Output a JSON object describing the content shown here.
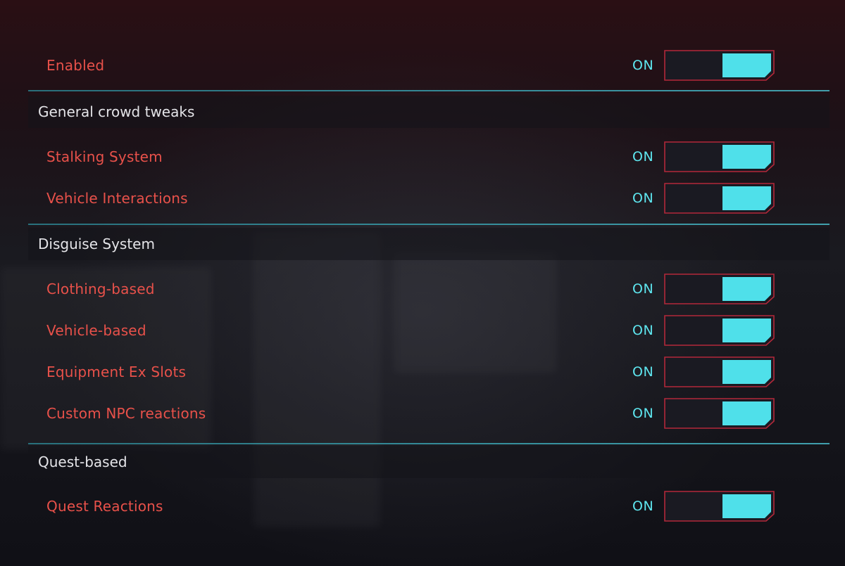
{
  "colors": {
    "label_red": "#e8514a",
    "on_cyan": "#5ee6ef",
    "toggle_fill": "#4fe0ea",
    "toggle_border": "#b3283a",
    "section_text": "#e4e4e8",
    "separator": "#3aa3b1"
  },
  "settings": {
    "enabled": {
      "label": "Enabled",
      "state": "ON"
    },
    "general": {
      "title": "General crowd tweaks",
      "items": [
        {
          "label": "Stalking System",
          "state": "ON"
        },
        {
          "label": "Vehicle Interactions",
          "state": "ON"
        }
      ]
    },
    "disguise": {
      "title": "Disguise System",
      "items": [
        {
          "label": "Clothing-based",
          "state": "ON"
        },
        {
          "label": "Vehicle-based",
          "state": "ON"
        },
        {
          "label": "Equipment Ex Slots",
          "state": "ON"
        },
        {
          "label": "Custom NPC reactions",
          "state": "ON"
        }
      ]
    },
    "quest": {
      "title": "Quest-based",
      "items": [
        {
          "label": "Quest Reactions",
          "state": "ON"
        }
      ]
    }
  }
}
